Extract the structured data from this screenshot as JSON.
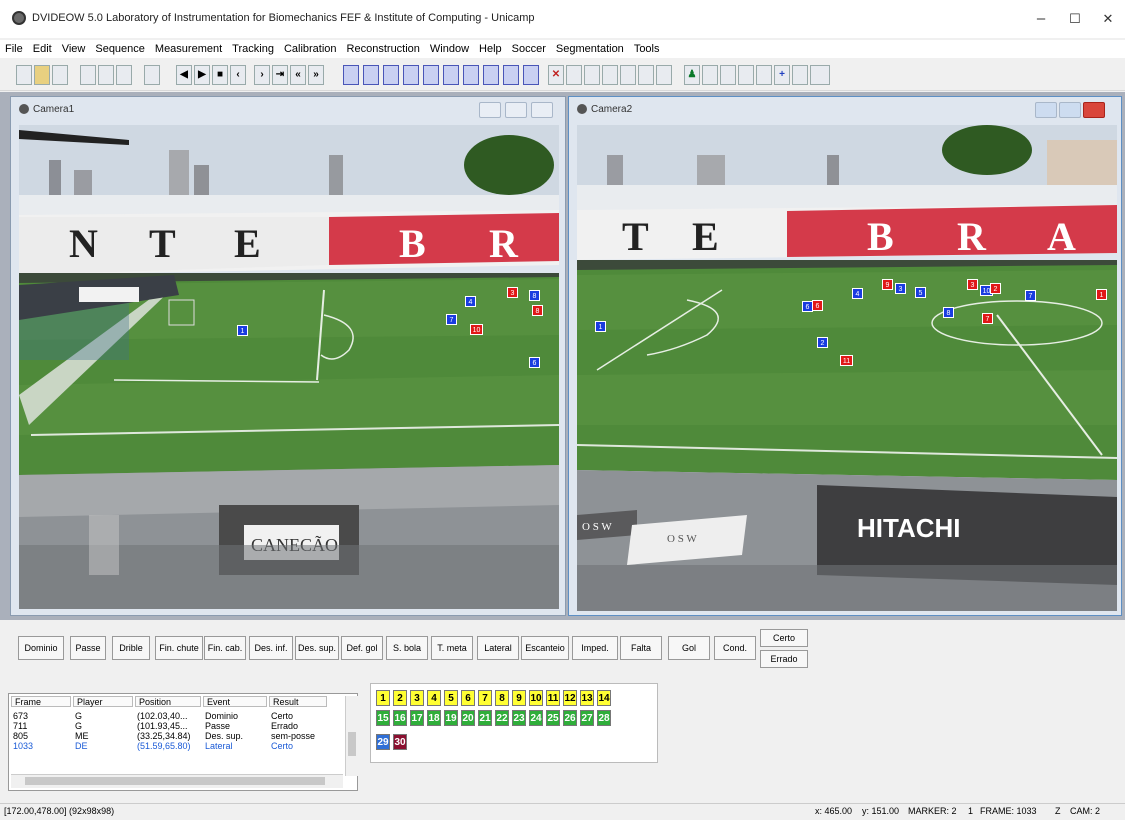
{
  "window": {
    "title": "DVIDEOW 5.0  Laboratory of Instrumentation for Biomechanics FEF & Institute of Computing - Unicamp",
    "minimize": "–",
    "maximize": "☐",
    "close": "✕"
  },
  "menu": [
    "File",
    "Edit",
    "View",
    "Sequence",
    "Measurement",
    "Tracking",
    "Calibration",
    "Reconstruction",
    "Window",
    "Help",
    "Soccer",
    "Segmentation",
    "Tools"
  ],
  "cameras": {
    "cam1": {
      "title": "Camera1"
    },
    "cam2": {
      "title": "Camera2"
    }
  },
  "scene": {
    "stand_letters_cam1": [
      "N",
      "T",
      "E",
      "B",
      "R"
    ],
    "stand_letters_cam2": [
      "T",
      "E",
      "B",
      "R",
      "A"
    ],
    "banner_cam1": "CANECÃO",
    "banner_cam2": "HITACHI",
    "osw": "O S W"
  },
  "markers_cam1": [
    {
      "label": "1",
      "team": "blue"
    },
    {
      "label": "4",
      "team": "blue"
    },
    {
      "label": "7",
      "team": "blue"
    },
    {
      "label": "8",
      "team": "blue"
    },
    {
      "label": "6",
      "team": "blue"
    },
    {
      "label": "3",
      "team": "red"
    },
    {
      "label": "8",
      "team": "red"
    },
    {
      "label": "10",
      "team": "red"
    }
  ],
  "markers_cam2": [
    {
      "label": "1",
      "team": "blue"
    },
    {
      "label": "6",
      "team": "blue"
    },
    {
      "label": "2",
      "team": "blue"
    },
    {
      "label": "4",
      "team": "blue"
    },
    {
      "label": "3",
      "team": "blue"
    },
    {
      "label": "10",
      "team": "blue"
    },
    {
      "label": "5",
      "team": "blue"
    },
    {
      "label": "8",
      "team": "blue"
    },
    {
      "label": "7",
      "team": "blue"
    },
    {
      "label": "9",
      "team": "red"
    },
    {
      "label": "11",
      "team": "red"
    },
    {
      "label": "3",
      "team": "red"
    },
    {
      "label": "6",
      "team": "red"
    },
    {
      "label": "7",
      "team": "red"
    },
    {
      "label": "2",
      "team": "red"
    },
    {
      "label": "1",
      "team": "red"
    }
  ],
  "event_buttons": [
    "Dominio",
    "Passe",
    "Drible",
    "Fin. chute",
    "Fin. cab.",
    "Des. inf.",
    "Des. sup.",
    "Def. gol",
    "S. bola",
    "T. meta",
    "Lateral",
    "Escanteio",
    "Imped.",
    "Falta",
    "Gol",
    "Cond."
  ],
  "result_buttons": {
    "certo": "Certo",
    "errado": "Errado"
  },
  "table": {
    "headers": [
      "Frame",
      "Player",
      "Position",
      "Event",
      "Result"
    ],
    "rows": [
      [
        "673",
        "G",
        "(102.03,40...",
        "Dominio",
        "Certo"
      ],
      [
        "711",
        "G",
        "(101.93,45...",
        "Passe",
        "Errado"
      ],
      [
        "805",
        "ME",
        "(33.25,34.84)",
        "Des. sup.",
        "sem-posse"
      ],
      [
        "1033",
        "DE",
        "(51.59,65.80)",
        "Lateral",
        "Certo"
      ]
    ]
  },
  "player_numbers": {
    "yellow": [
      "1",
      "2",
      "3",
      "4",
      "5",
      "6",
      "7",
      "8",
      "9",
      "10",
      "11",
      "12",
      "13",
      "14"
    ],
    "green": [
      "15",
      "16",
      "17",
      "18",
      "19",
      "20",
      "21",
      "22",
      "23",
      "24",
      "25",
      "26",
      "27",
      "28"
    ],
    "blue": [
      "29"
    ],
    "maroon": [
      "30"
    ]
  },
  "status": {
    "left": "[172.00,478.00] (92x98x98)",
    "x": "x: 465.00",
    "y": "y: 151.00",
    "marker": "MARKER: 2",
    "one": "1",
    "frame": "FRAME: 1033",
    "z": "Z",
    "cam": "CAM: 2"
  },
  "colors": {
    "blue_marker": "#1a3ce0",
    "red_marker": "#e01818",
    "pitch": "#4f8a3a"
  }
}
